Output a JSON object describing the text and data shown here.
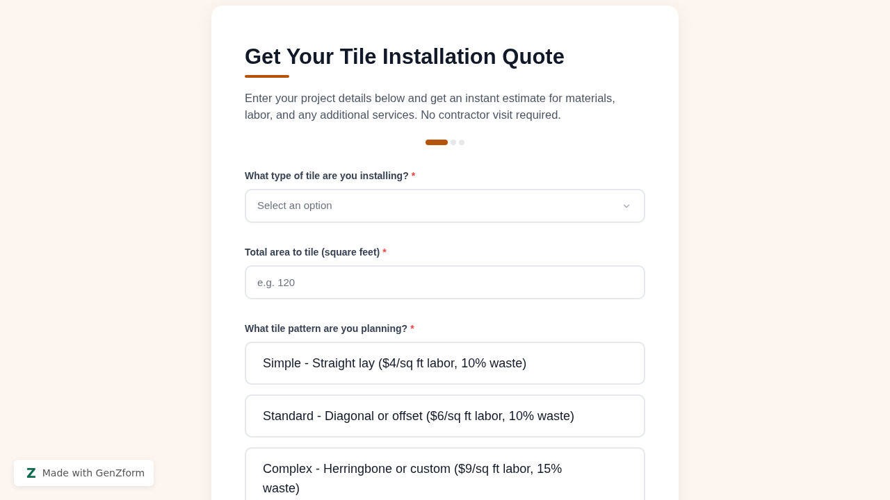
{
  "form": {
    "title": "Get Your Tile Installation Quote",
    "description": "Enter your project details below and get an instant estimate for materials, labor, and any additional services. No contractor visit required.",
    "steps": [
      {
        "selected": true
      },
      {
        "selected": false
      },
      {
        "selected": false
      }
    ],
    "fields": [
      {
        "kind": "select",
        "label": "What type of tile are you installing?",
        "required_mark": "*",
        "placeholder": "Select an option"
      },
      {
        "kind": "input",
        "label": "Total area to tile (square feet)",
        "required_mark": "*",
        "placeholder": "e.g. 120"
      },
      {
        "kind": "choices",
        "label": "What tile pattern are you planning?",
        "required_mark": "*",
        "options": [
          {
            "label": "Simple - Straight lay ($4/sq ft labor, 10% waste)",
            "selected": false
          },
          {
            "label": "Standard - Diagonal or offset ($6/sq ft labor, 10% waste)",
            "selected": false
          },
          {
            "label": "Complex - Herringbone or custom ($9/sq ft labor, 15% waste)",
            "selected": false
          }
        ]
      }
    ]
  },
  "badge": {
    "logo": "Z",
    "text": "Made with GenZform"
  }
}
